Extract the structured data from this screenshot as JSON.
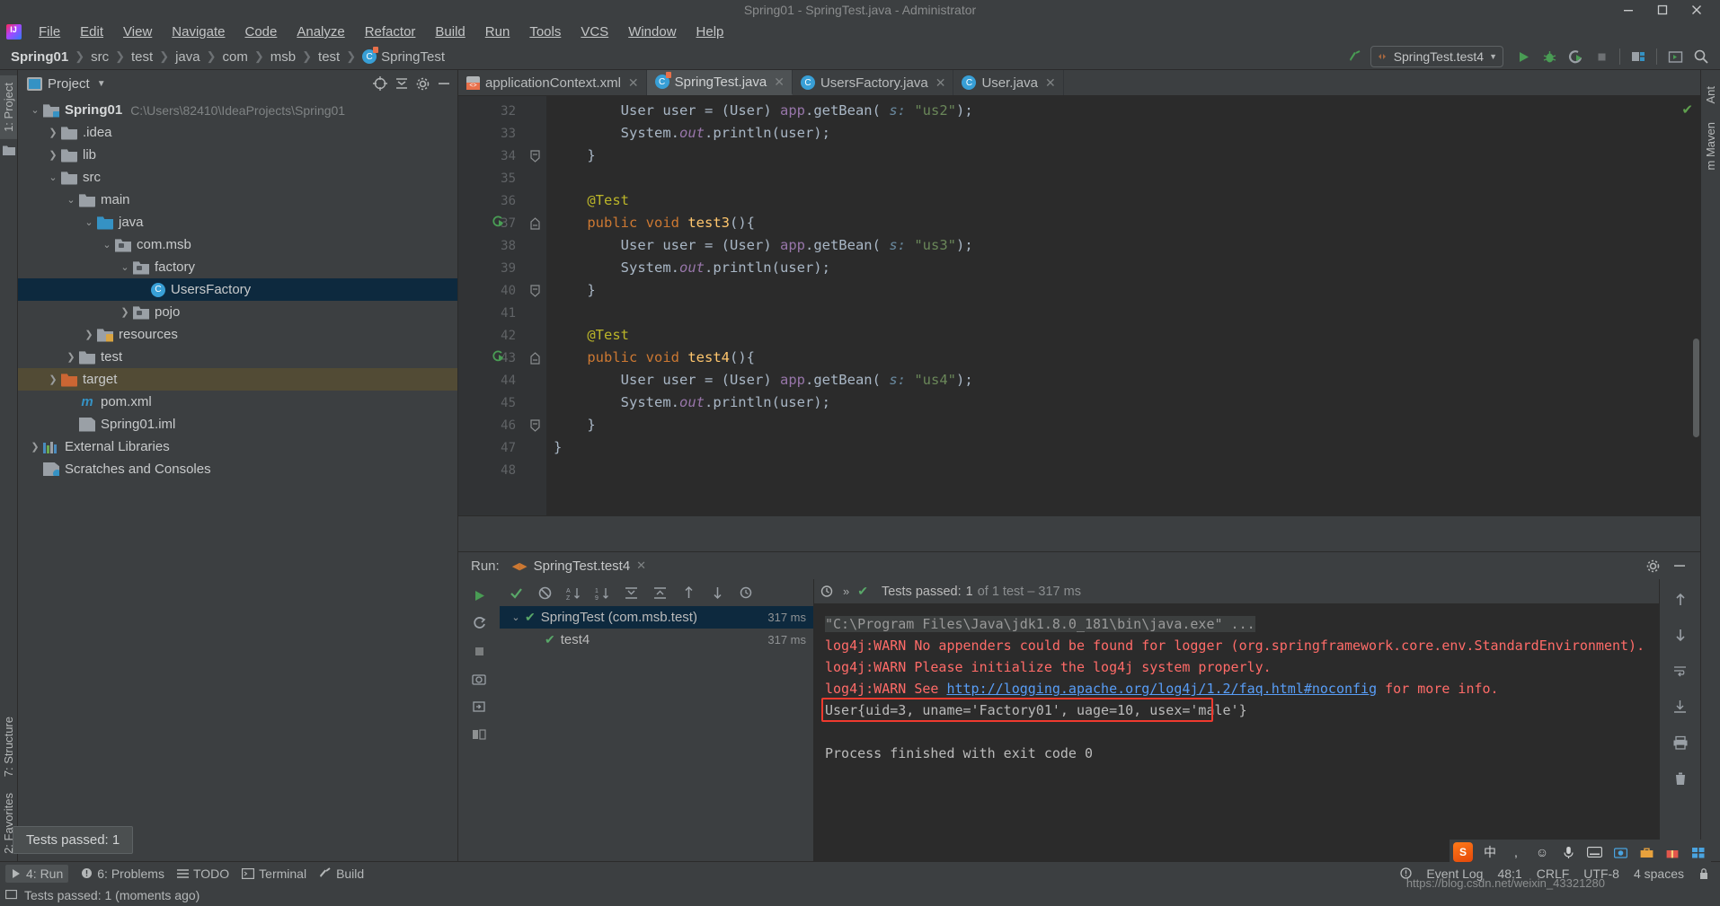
{
  "window": {
    "title": "Spring01 - SpringTest.java - Administrator",
    "buttons": [
      "minimize",
      "maximize",
      "close"
    ]
  },
  "menu": {
    "items": [
      "File",
      "Edit",
      "View",
      "Navigate",
      "Code",
      "Analyze",
      "Refactor",
      "Build",
      "Run",
      "Tools",
      "VCS",
      "Window",
      "Help"
    ]
  },
  "navbar": {
    "breadcrumb": [
      "Spring01",
      "src",
      "test",
      "java",
      "com",
      "msb",
      "test",
      "SpringTest"
    ],
    "run_config": "SpringTest.test4",
    "icons": [
      "build-icon",
      "run-icon",
      "debug-icon",
      "run-coverage-icon",
      "stop-icon",
      "project-structure-icon",
      "terminal-icon",
      "search-icon"
    ]
  },
  "left_strip": {
    "tabs": [
      "1: Project"
    ],
    "bottom_tabs": [
      "2: Favorites",
      "7: Structure"
    ]
  },
  "right_strip": {
    "tabs": [
      "Ant",
      "m Maven"
    ]
  },
  "project_panel": {
    "title": "Project",
    "tree": [
      {
        "depth": 0,
        "arrow": "down",
        "icon": "module-folder-icon",
        "label": "Spring01",
        "bold": true,
        "path": "C:\\Users\\82410\\IdeaProjects\\Spring01",
        "state": "normal"
      },
      {
        "depth": 1,
        "arrow": "right",
        "icon": "folder-icon",
        "label": ".idea",
        "state": "normal"
      },
      {
        "depth": 1,
        "arrow": "right",
        "icon": "folder-icon",
        "label": "lib",
        "state": "normal"
      },
      {
        "depth": 1,
        "arrow": "down",
        "icon": "folder-icon",
        "label": "src",
        "state": "normal"
      },
      {
        "depth": 2,
        "arrow": "down",
        "icon": "folder-icon",
        "label": "main",
        "state": "normal"
      },
      {
        "depth": 3,
        "arrow": "down",
        "icon": "source-folder-icon",
        "label": "java",
        "state": "normal"
      },
      {
        "depth": 4,
        "arrow": "down",
        "icon": "package-icon",
        "label": "com.msb",
        "state": "normal"
      },
      {
        "depth": 5,
        "arrow": "down",
        "icon": "package-icon",
        "label": "factory",
        "state": "normal"
      },
      {
        "depth": 6,
        "arrow": "none",
        "icon": "class-icon",
        "label": "UsersFactory",
        "state": "selected"
      },
      {
        "depth": 5,
        "arrow": "right",
        "icon": "package-icon",
        "label": "pojo",
        "state": "normal"
      },
      {
        "depth": 3,
        "arrow": "right",
        "icon": "resource-folder-icon",
        "label": "resources",
        "state": "normal"
      },
      {
        "depth": 2,
        "arrow": "right",
        "icon": "folder-icon",
        "label": "test",
        "state": "normal"
      },
      {
        "depth": 1,
        "arrow": "right",
        "icon": "excluded-folder-icon",
        "label": "target",
        "state": "excluded"
      },
      {
        "depth": 2,
        "arrow": "none",
        "icon": "maven-icon",
        "label": "pom.xml",
        "state": "normal"
      },
      {
        "depth": 2,
        "arrow": "none",
        "icon": "iml-icon",
        "label": "Spring01.iml",
        "state": "normal"
      },
      {
        "depth": 0,
        "arrow": "right",
        "icon": "libraries-icon",
        "label": "External Libraries",
        "state": "normal"
      },
      {
        "depth": 0,
        "arrow": "none",
        "icon": "scratches-icon",
        "label": "Scratches and Consoles",
        "state": "normal"
      }
    ]
  },
  "editor": {
    "tabs": [
      {
        "label": "applicationContext.xml",
        "icon": "xml-file-icon",
        "active": false
      },
      {
        "label": "SpringTest.java",
        "icon": "test-class-icon",
        "active": true
      },
      {
        "label": "UsersFactory.java",
        "icon": "class-icon",
        "active": false
      },
      {
        "label": "User.java",
        "icon": "class-icon",
        "active": false
      }
    ],
    "first_line_number": 32,
    "lines": [
      {
        "n": 32,
        "gutter": "",
        "fold": "",
        "html": "        <span class=\"cls\">User</span> user = (<span class=\"cls\">User</span>) <span class=\"fld\">app</span>.getBean( <span class=\"hint\">s:</span> <span class=\"str\">\"us2\"</span>);"
      },
      {
        "n": 33,
        "gutter": "",
        "fold": "",
        "html": "        System.<span class=\"fld\"><i>out</i></span>.println(user);"
      },
      {
        "n": 34,
        "gutter": "",
        "fold": "end",
        "html": "    }"
      },
      {
        "n": 35,
        "gutter": "",
        "fold": "",
        "html": ""
      },
      {
        "n": 36,
        "gutter": "",
        "fold": "",
        "html": "    <span class=\"ann\">@Test</span>"
      },
      {
        "n": 37,
        "gutter": "run",
        "fold": "start",
        "html": "    <span class=\"kw\">public void</span> <span class=\"mth\">test3</span>(){"
      },
      {
        "n": 38,
        "gutter": "",
        "fold": "",
        "html": "        <span class=\"cls\">User</span> user = (<span class=\"cls\">User</span>) <span class=\"fld\">app</span>.getBean( <span class=\"hint\">s:</span> <span class=\"str\">\"us3\"</span>);"
      },
      {
        "n": 39,
        "gutter": "",
        "fold": "",
        "html": "        System.<span class=\"fld\"><i>out</i></span>.println(user);"
      },
      {
        "n": 40,
        "gutter": "",
        "fold": "end",
        "html": "    }"
      },
      {
        "n": 41,
        "gutter": "",
        "fold": "",
        "html": ""
      },
      {
        "n": 42,
        "gutter": "",
        "fold": "",
        "html": "    <span class=\"ann\">@Test</span>"
      },
      {
        "n": 43,
        "gutter": "run",
        "fold": "start",
        "html": "    <span class=\"kw\">public void</span> <span class=\"mth\">test4</span>(){"
      },
      {
        "n": 44,
        "gutter": "",
        "fold": "",
        "html": "        <span class=\"cls\">User</span> user = (<span class=\"cls\">User</span>) <span class=\"fld\">app</span>.getBean( <span class=\"hint\">s:</span> <span class=\"str\">\"us4\"</span>);"
      },
      {
        "n": 45,
        "gutter": "",
        "fold": "",
        "html": "        System.<span class=\"fld\"><i>out</i></span>.println(user);"
      },
      {
        "n": 46,
        "gutter": "",
        "fold": "end",
        "html": "    }"
      },
      {
        "n": 47,
        "gutter": "",
        "fold": "",
        "html": "}"
      },
      {
        "n": 48,
        "gutter": "",
        "fold": "",
        "html": ""
      }
    ]
  },
  "run_panel": {
    "label": "Run:",
    "tab": "SpringTest.test4",
    "tree": [
      {
        "depth": 0,
        "label": "SpringTest (com.msb.test)",
        "time": "317 ms",
        "selected": true,
        "arrow": "down"
      },
      {
        "depth": 1,
        "label": "test4",
        "time": "317 ms",
        "selected": false,
        "arrow": "none"
      }
    ],
    "status": {
      "passed_prefix": "Tests passed:",
      "passed_count": "1",
      "detail": "of 1 test – 317 ms"
    },
    "console": [
      {
        "style": "gray",
        "text": "\"C:\\Program Files\\Java\\jdk1.8.0_181\\bin\\java.exe\" ..."
      },
      {
        "style": "red",
        "text": "log4j:WARN No appenders could be found for logger (org.springframework.core.env.StandardEnvironment)."
      },
      {
        "style": "red",
        "text": "log4j:WARN Please initialize the log4j system properly."
      },
      {
        "style": "red-link",
        "text_before": "log4j:WARN See ",
        "link": "http://logging.apache.org/log4j/1.2/faq.html#noconfig",
        "text_after": " for more info."
      },
      {
        "style": "white-highlighted",
        "text": "User{uid=3, uname='Factory01', uage=10, usex='male'}"
      },
      {
        "style": "blank",
        "text": ""
      },
      {
        "style": "white",
        "text": "Process finished with exit code 0"
      }
    ],
    "highlight_color": "#f03a2e"
  },
  "tooltip": {
    "text": "Tests passed: 1"
  },
  "status_bar": {
    "items": [
      "4: Run",
      "6: Problems",
      "TODO",
      "Terminal",
      "Build"
    ],
    "message": "Tests passed: 1 (moments ago)",
    "event_log": "Event Log",
    "caret": "48:1",
    "line_sep": "CRLF",
    "encoding": "UTF-8",
    "indent": "4 spaces"
  },
  "ime": {
    "lang": "中",
    "items": [
      "sogou-logo",
      "中",
      "，",
      "emoji-icon",
      "mic-icon",
      "keyboard-icon",
      "screenshot-icon",
      "toolbox-icon",
      "gift-icon",
      "menu-icon"
    ]
  },
  "watermark": {
    "url": "https://blog.csdn.net/weixin_43321280"
  }
}
